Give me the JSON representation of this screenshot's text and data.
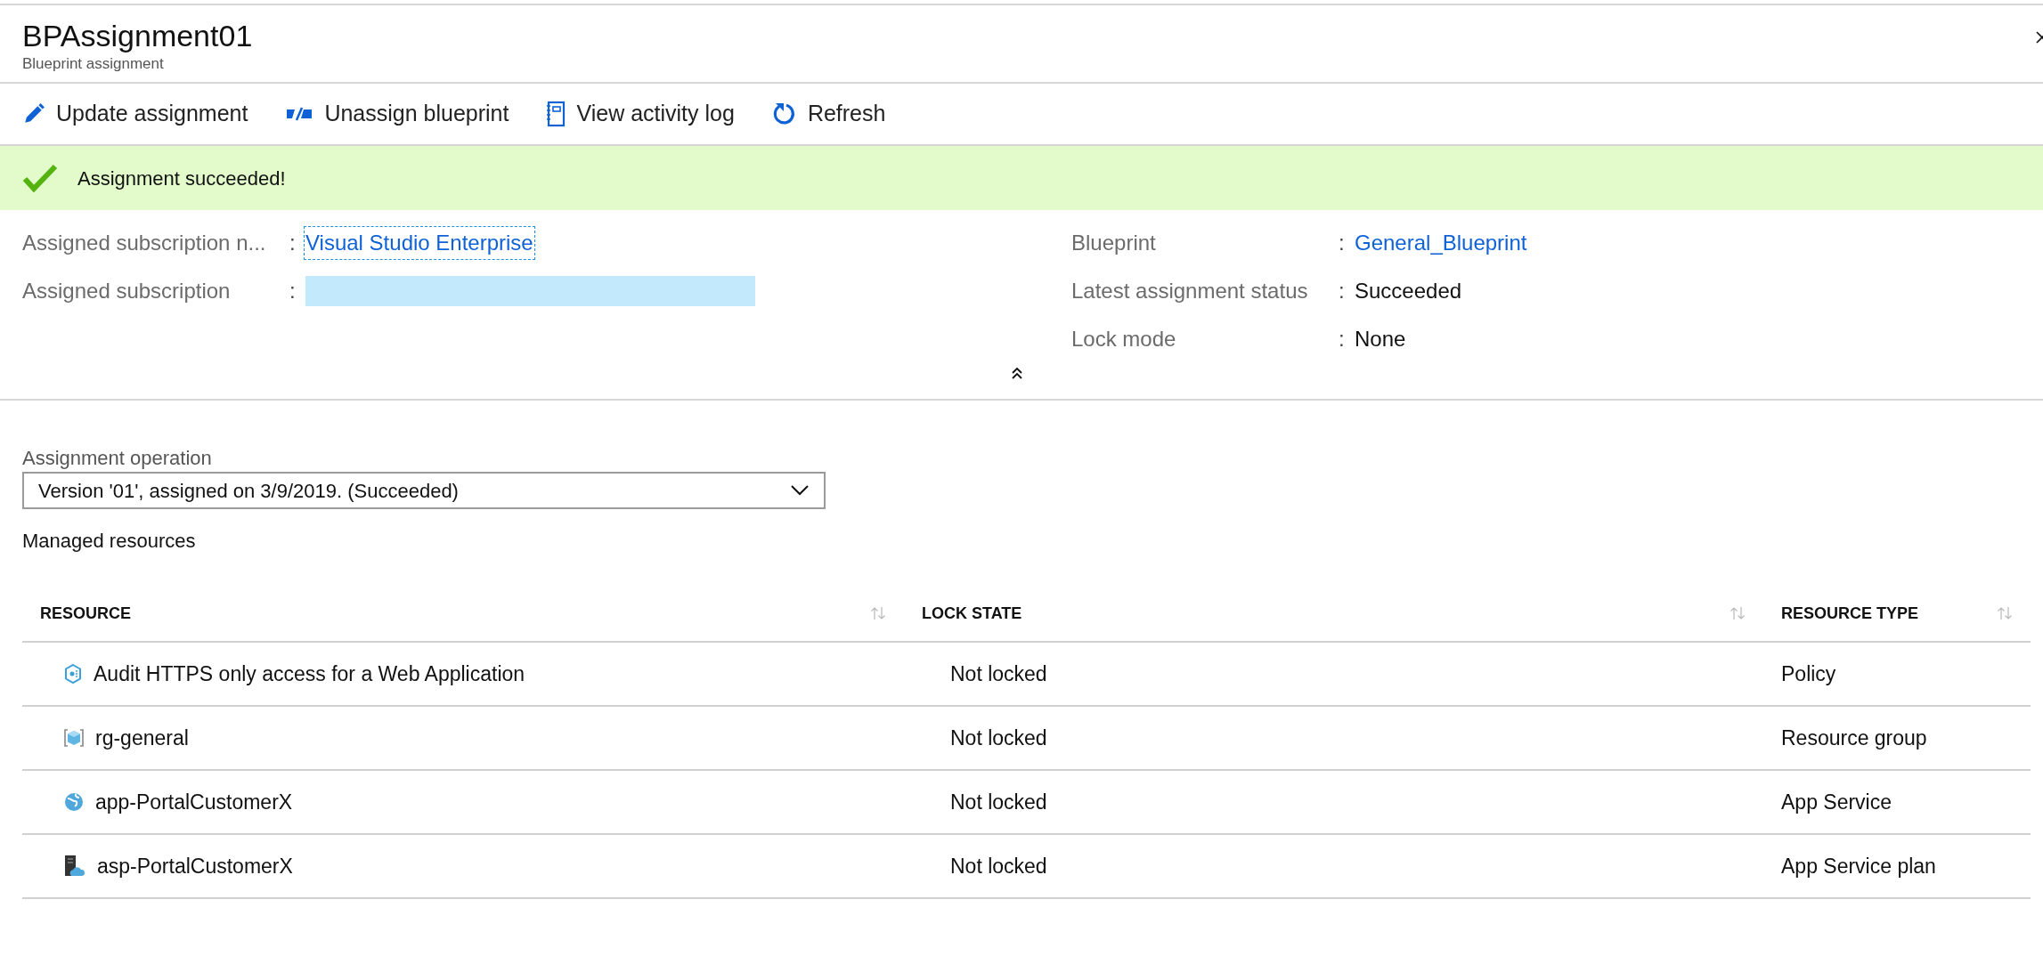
{
  "header": {
    "title": "BPAssignment01",
    "subtitle": "Blueprint assignment"
  },
  "toolbar": [
    {
      "kind": "edit",
      "label": "Update assignment"
    },
    {
      "kind": "unassign",
      "label": "Unassign blueprint"
    },
    {
      "kind": "log",
      "label": "View activity log"
    },
    {
      "kind": "refresh",
      "label": "Refresh"
    }
  ],
  "notification": {
    "message": "Assignment succeeded!"
  },
  "details_left": [
    {
      "label": "Assigned subscription n...",
      "separator": ":",
      "value": "Visual Studio Enterprise",
      "link": true,
      "focused": true
    },
    {
      "label": "Assigned subscription",
      "separator": ":",
      "redacted": true
    }
  ],
  "details_right": [
    {
      "label": "Blueprint",
      "separator": ":",
      "value": "General_Blueprint",
      "link": true,
      "focused": false
    },
    {
      "label": "Latest assignment status",
      "separator": ":",
      "value": "Succeeded",
      "link": false,
      "focused": false
    },
    {
      "label": "Lock mode",
      "separator": ":",
      "value": "None",
      "link": false,
      "focused": false
    }
  ],
  "operation": {
    "label": "Assignment operation",
    "value": "Version '01', assigned on 3/9/2019. (Succeeded)"
  },
  "table": {
    "title": "Managed resources",
    "columns": [
      "RESOURCE",
      "LOCK STATE",
      "RESOURCE TYPE"
    ],
    "rows": [
      {
        "kind": "policy",
        "resource": "Audit HTTPS only access for a Web Application",
        "lock_state": "Not locked",
        "resource_type": "Policy"
      },
      {
        "kind": "resource-group",
        "resource": "rg-general",
        "lock_state": "Not locked",
        "resource_type": "Resource group"
      },
      {
        "kind": "app-service",
        "resource": "app-PortalCustomerX",
        "lock_state": "Not locked",
        "resource_type": "App Service"
      },
      {
        "kind": "app-service-plan",
        "resource": "asp-PortalCustomerX",
        "lock_state": "Not locked",
        "resource_type": "App Service plan"
      }
    ]
  }
}
